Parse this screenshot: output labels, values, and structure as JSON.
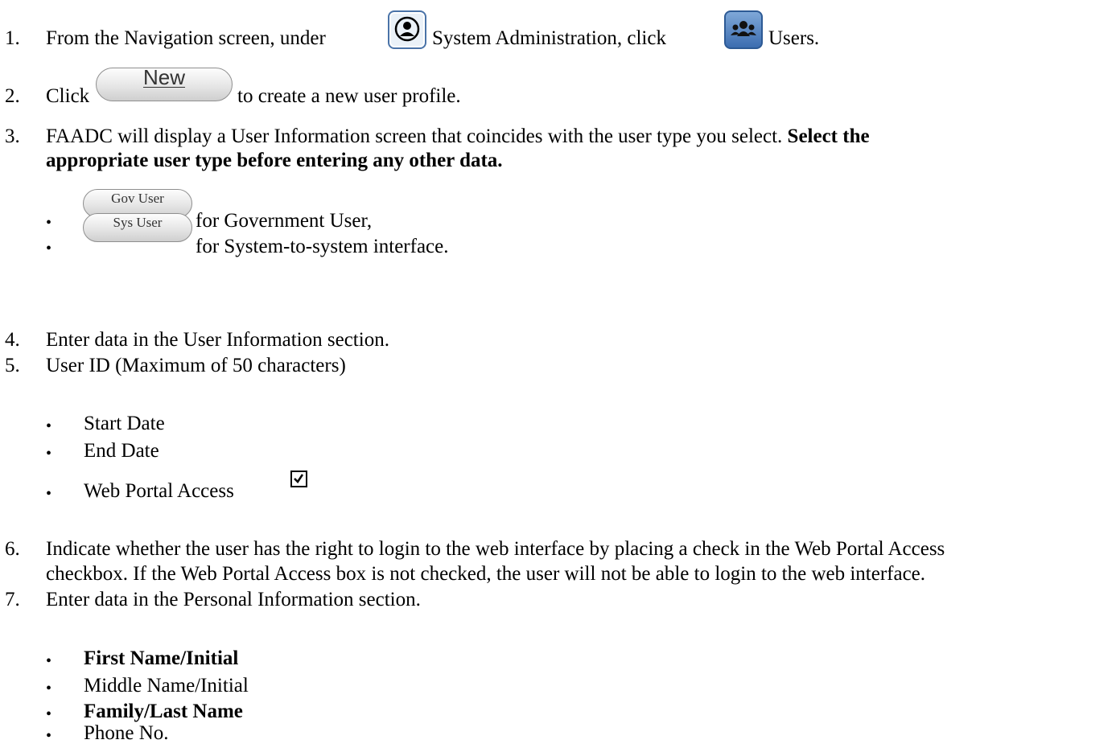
{
  "steps": [
    {
      "number": "1.",
      "text_before": "From the Navigation screen, under",
      "icon_label": "System Administration, click",
      "after_icon_label": "Users."
    },
    {
      "number": "2.",
      "text_before": "Click",
      "button_label": "New",
      "text_after": "to create a new user profile."
    },
    {
      "number": "3.",
      "line1_text": "FAADC will display a User Information screen that coincides with the user type you select.",
      "line1_bold": "Select the",
      "line2_bold": "appropriate user type before entering any other data."
    },
    {
      "number": "4.",
      "text": "Enter data in the User Information section."
    },
    {
      "number": "5.",
      "text": "User ID (Maximum of 50 characters)"
    },
    {
      "number": "6.",
      "line1": "Indicate whether the user has the right to login to the web interface by placing a check in the Web Portal Access",
      "line2": "checkbox. If the Web Portal Access box is not checked, the user will not be able to login to the web interface."
    },
    {
      "number": "7.",
      "text": "Enter data in the Personal Information section."
    }
  ],
  "user_type_buttons": [
    {
      "label": "Gov User",
      "description": "for Government User,"
    },
    {
      "label": "Sys User",
      "description": "for System-to-system interface."
    }
  ],
  "user_info_fields": [
    "Start Date",
    "End Date",
    "Web Portal Access"
  ],
  "personal_fields": [
    "First Name/Initial",
    "Middle Name/Initial",
    "Family/Last Name",
    "Phone No."
  ],
  "bullet_char": "•"
}
